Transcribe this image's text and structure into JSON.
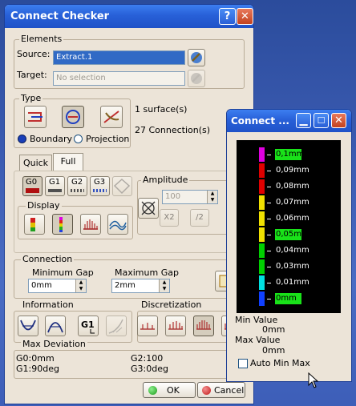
{
  "main": {
    "title": "Connect Checker",
    "elements": {
      "label": "Elements",
      "source_label": "Source:",
      "source_value": "Extract.1",
      "target_label": "Target:",
      "target_placeholder": "No selection"
    },
    "type": {
      "label": "Type",
      "boundary": "Boundary",
      "projection": "Projection",
      "surfaces_count": "1 surface(s)",
      "connections_count": "27 Connection(s)"
    },
    "tabs": [
      "Quick",
      "Full"
    ],
    "continuity": [
      "G0",
      "G1",
      "G2",
      "G3"
    ],
    "amplitude": {
      "label": "Amplitude",
      "value": "100",
      "x2": "X2",
      "div2": "/2"
    },
    "display_label": "Display",
    "connection": {
      "label": "Connection",
      "min_gap_label": "Minimum Gap",
      "min_gap_value": "0mm",
      "max_gap_label": "Maximum Gap",
      "max_gap_value": "2mm"
    },
    "information_label": "Information",
    "discretization_label": "Discretization",
    "max_deviation": {
      "label": "Max Deviation",
      "g0": "G0:0mm",
      "g1": "G1:90deg",
      "g2": "G2:100",
      "g3": "G3:0deg"
    },
    "buttons": {
      "ok": "OK",
      "cancel": "Cancel"
    }
  },
  "scale": {
    "title": "Connect ...",
    "labels": [
      "0,1mm",
      "0,09mm",
      "0,08mm",
      "0,07mm",
      "0,06mm",
      "0,05mm",
      "0,04mm",
      "0,03mm",
      "0,01mm",
      "0mm"
    ],
    "highlighted": [
      true,
      false,
      false,
      false,
      false,
      true,
      false,
      false,
      false,
      true
    ],
    "colors": [
      "#e000e0",
      "#e00000",
      "#e00000",
      "#f0e000",
      "#f0e000",
      "#f0e000",
      "#00d000",
      "#00d000",
      "#00e0e0",
      "#1040ff"
    ],
    "min_value_label": "Min Value",
    "min_value": "0mm",
    "max_value_label": "Max Value",
    "max_value": "0mm",
    "auto_min_max": "Auto Min Max",
    "auto_min_max_checked": false
  },
  "colors": {
    "title_bar": "#2860d8",
    "dialog_bg": "#ece4d8",
    "selection": "#316ac5",
    "highlight_green": "#19e219"
  }
}
